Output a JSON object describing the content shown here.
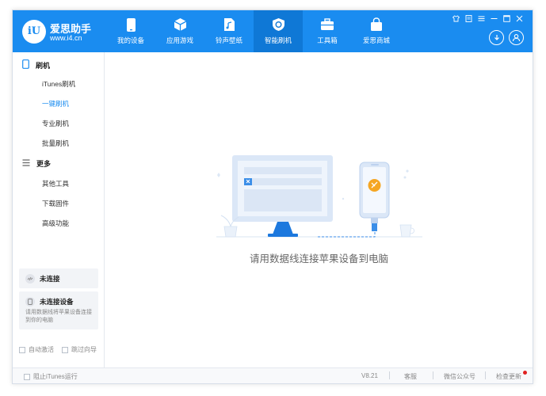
{
  "brand": {
    "name": "爱思助手",
    "url": "www.i4.cn",
    "logo_text": "iU"
  },
  "nav": [
    {
      "label": "我的设备",
      "icon": "phone-icon"
    },
    {
      "label": "应用游戏",
      "icon": "cube-icon"
    },
    {
      "label": "铃声壁纸",
      "icon": "music-file-icon"
    },
    {
      "label": "智能刷机",
      "icon": "refresh-shield-icon",
      "active": true
    },
    {
      "label": "工具箱",
      "icon": "toolbox-icon"
    },
    {
      "label": "爱思商城",
      "icon": "shopping-bag-icon"
    }
  ],
  "window_controls": [
    "shirt-icon",
    "note-icon",
    "menu-icon",
    "minimize-icon",
    "maximize-icon",
    "close-icon"
  ],
  "sidebar": {
    "flash_section": "刷机",
    "flash_items": [
      "iTunes刷机",
      "一键刷机",
      "专业刷机",
      "批量刷机"
    ],
    "more_section": "更多",
    "more_items": [
      "其他工具",
      "下载固件",
      "高级功能"
    ],
    "connection_status": "未连接",
    "device_status": "未连接设备",
    "device_hint": "请用数据线将苹果设备连接到你的电脑",
    "auto_activate": "自动激活",
    "skip_guide": "跳过向导"
  },
  "main": {
    "empty_message": "请用数据线连接苹果设备到电脑"
  },
  "footer": {
    "block_itunes": "阻止iTunes运行",
    "version": "V8.21",
    "support": "客服",
    "wechat": "微信公众号",
    "check_update": "检查更新"
  },
  "colors": {
    "accent": "#1a8cf0",
    "update_dot": "#e02020"
  }
}
